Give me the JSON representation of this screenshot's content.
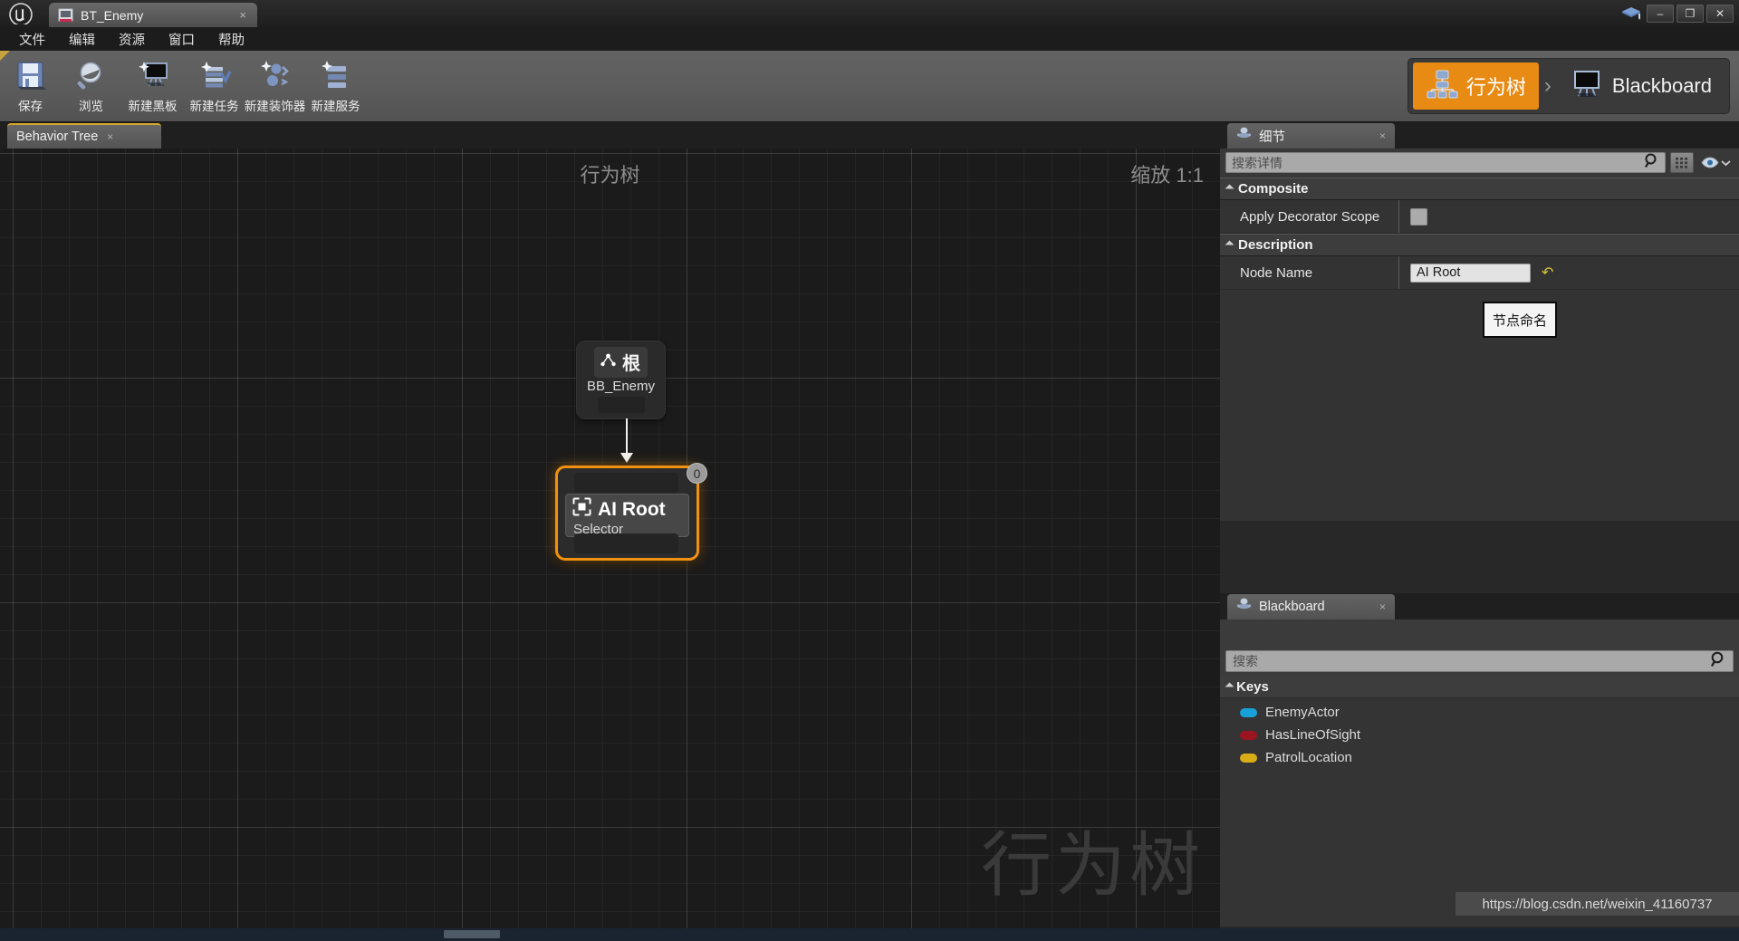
{
  "window": {
    "app_logo": "unreal-logo",
    "document_tab": {
      "title": "BT_Enemy",
      "close": "×"
    },
    "controls": {
      "minimize": "–",
      "maximize": "❐",
      "close": "✕"
    }
  },
  "menubar": {
    "items": [
      {
        "label": "文件"
      },
      {
        "label": "编辑"
      },
      {
        "label": "资源"
      },
      {
        "label": "窗口"
      },
      {
        "label": "帮助"
      }
    ]
  },
  "toolbar": {
    "buttons": [
      {
        "label": "保存",
        "icon": "save-icon"
      },
      {
        "label": "浏览",
        "icon": "browse-icon"
      },
      {
        "label": "新建黑板",
        "icon": "new-blackboard-icon"
      },
      {
        "label": "新建任务",
        "icon": "new-task-icon"
      },
      {
        "label": "新建装饰器",
        "icon": "new-decorator-icon"
      },
      {
        "label": "新建服务",
        "icon": "new-service-icon"
      }
    ],
    "modes": [
      {
        "label": "行为树",
        "icon": "behavior-tree-icon",
        "active": true
      },
      {
        "label": "Blackboard",
        "icon": "blackboard-icon",
        "active": false
      }
    ],
    "mode_separator": "›"
  },
  "graph": {
    "tab": {
      "label": "Behavior Tree",
      "close": "×"
    },
    "title": "行为树",
    "zoom": "缩放 1:1",
    "watermark": "行为树",
    "nodes": [
      {
        "title": "根",
        "subtitle": "BB_Enemy",
        "icon": "root-node-icon",
        "selected": false
      },
      {
        "title": "AI Root",
        "subtitle": "Selector",
        "icon": "selector-node-icon",
        "index_badge": "0",
        "selected": true
      }
    ]
  },
  "details": {
    "tab": {
      "label": "细节",
      "icon": "details-panel-icon",
      "close": "×"
    },
    "search": {
      "placeholder": "搜索详情",
      "value": ""
    },
    "grid_button": "grid-view-icon",
    "eye_button": "visibility-icon",
    "categories": [
      {
        "name": "Composite",
        "rows": [
          {
            "label": "Apply Decorator Scope",
            "type": "checkbox",
            "checked": false
          }
        ]
      },
      {
        "name": "Description",
        "rows": [
          {
            "label": "Node Name",
            "type": "text",
            "value": "AI Root",
            "revert": "↶"
          }
        ]
      }
    ],
    "tooltip": "节点命名"
  },
  "blackboard": {
    "tab": {
      "label": "Blackboard",
      "icon": "blackboard-panel-icon",
      "close": "×"
    },
    "search": {
      "placeholder": "搜索",
      "value": ""
    },
    "section": "Keys",
    "keys": [
      {
        "name": "EnemyActor",
        "color": "#18a0d8"
      },
      {
        "name": "HasLineOfSight",
        "color": "#9b1420"
      },
      {
        "name": "PatrolLocation",
        "color": "#d8ad18"
      }
    ]
  },
  "footer": {
    "url": "https://blog.csdn.net/weixin_41160737"
  },
  "colors": {
    "accent_orange": "#e88b14",
    "selection_orange": "#f0920f",
    "tab_underline": "#d6a72a"
  }
}
